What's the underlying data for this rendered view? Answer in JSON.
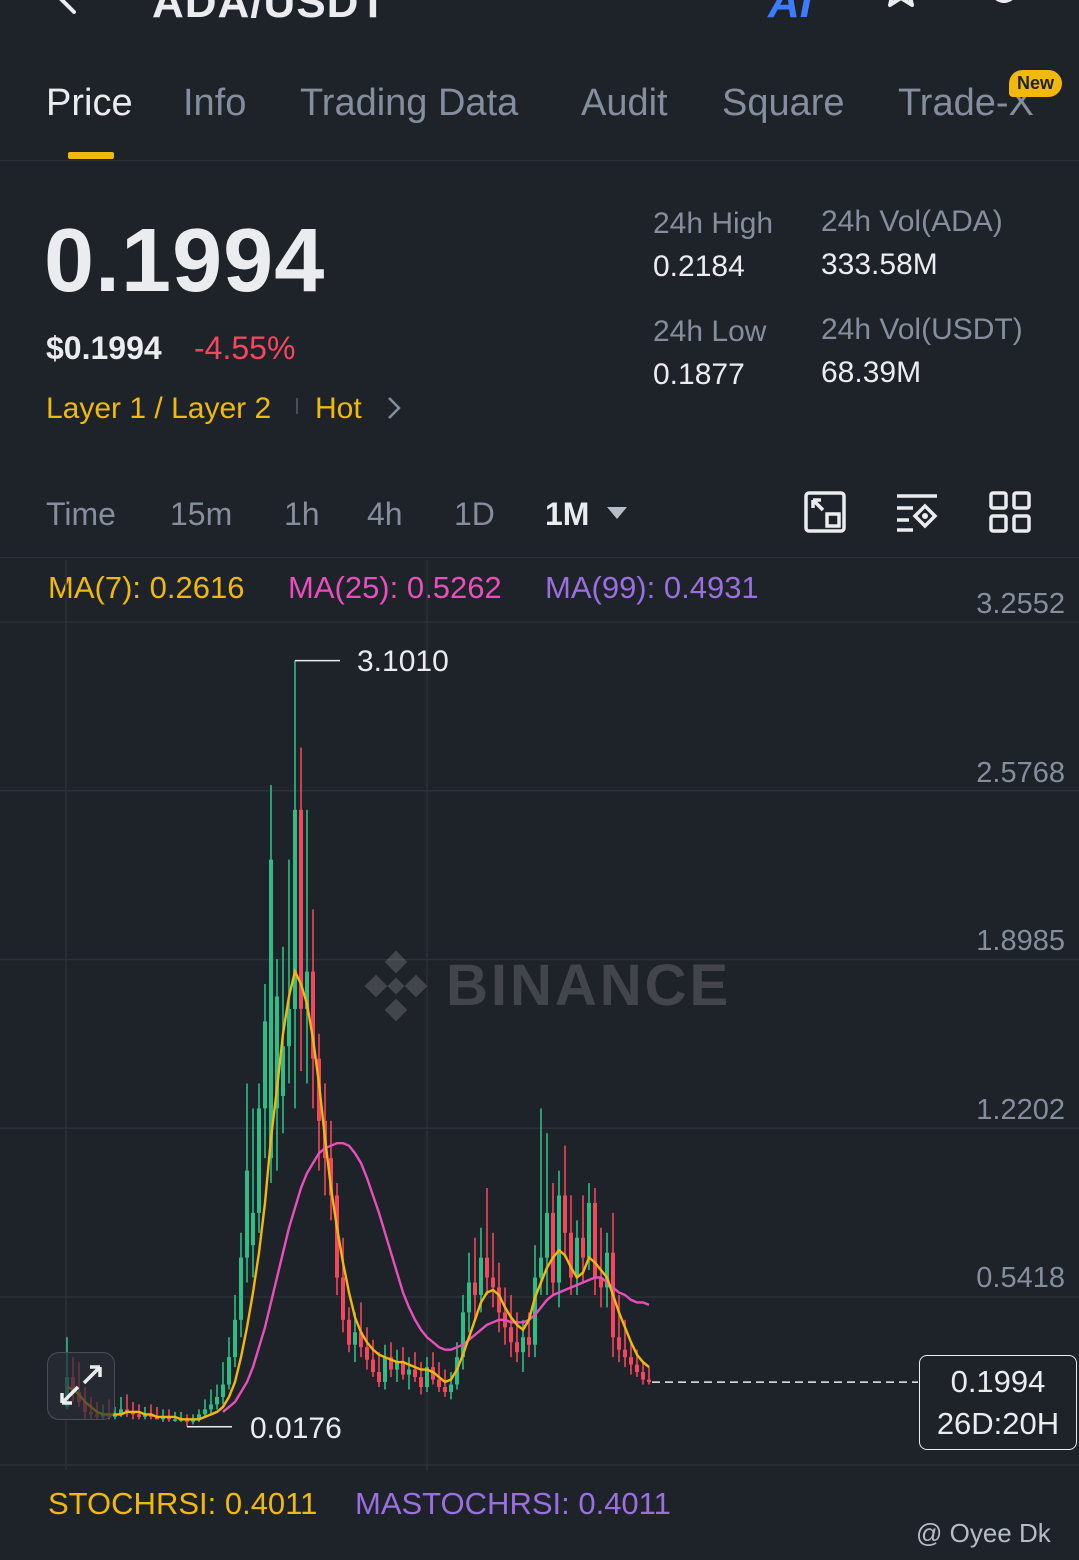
{
  "header": {
    "pair_title": "ADA/USDT",
    "ai_label": "AI",
    "icons": [
      "back-icon",
      "ai-icon",
      "star-icon",
      "bell-icon"
    ]
  },
  "tabs": [
    {
      "label": "Price",
      "active": true
    },
    {
      "label": "Info",
      "active": false
    },
    {
      "label": "Trading Data",
      "active": false
    },
    {
      "label": "Audit",
      "active": false
    },
    {
      "label": "Square",
      "active": false
    },
    {
      "label": "Trade-X",
      "active": false,
      "badge": "New"
    }
  ],
  "ticker": {
    "last_price": "0.1994",
    "usd_price": "$0.1994",
    "change_pct": "-4.55%",
    "tag_category": "Layer 1 / Layer 2",
    "tag_hot": "Hot",
    "stats": {
      "high_label": "24h High",
      "high_value": "0.2184",
      "low_label": "24h Low",
      "low_value": "0.1877",
      "vol_base_label": "24h Vol(ADA)",
      "vol_base_value": "333.58M",
      "vol_quote_label": "24h Vol(USDT)",
      "vol_quote_value": "68.39M"
    }
  },
  "intervals": {
    "items": [
      "Time",
      "15m",
      "1h",
      "4h",
      "1D",
      "1M"
    ],
    "active": "1M",
    "tools": [
      "chart-fullscreen-icon",
      "indicator-settings-icon",
      "layout-grid-icon"
    ]
  },
  "indicators": {
    "ma7": "MA(7): 0.2616",
    "ma25": "MA(25): 0.5262",
    "ma99": "MA(99): 0.4931",
    "stochrsi": "STOCHRSI: 0.4011",
    "mastochrsi": "MASTOCHRSI: 0.4011"
  },
  "chart": {
    "watermark": "BINANCE",
    "high_marker": "3.1010",
    "low_marker": "0.0176",
    "current_price": "0.1994",
    "countdown": "26D:20H",
    "credit": "@ Oyee Dk"
  },
  "chart_data": {
    "type": "candlestick",
    "y_ticks": [
      "3.2552",
      "2.5768",
      "1.8985",
      "1.2202",
      "0.5418"
    ],
    "ylim": [
      0.05,
      3.35
    ],
    "colors": {
      "up": "#2ebd85",
      "down": "#f6465d",
      "ma7": "#f0b90b",
      "ma25": "#e84fbd",
      "ma99": "#9b6fe0"
    },
    "candles": [
      [
        0.1,
        0.38,
        0.09,
        0.22
      ],
      [
        0.22,
        0.3,
        0.12,
        0.16
      ],
      [
        0.16,
        0.28,
        0.1,
        0.12
      ],
      [
        0.12,
        0.18,
        0.05,
        0.08
      ],
      [
        0.08,
        0.14,
        0.05,
        0.07
      ],
      [
        0.07,
        0.12,
        0.05,
        0.06
      ],
      [
        0.06,
        0.11,
        0.05,
        0.07
      ],
      [
        0.07,
        0.13,
        0.05,
        0.06
      ],
      [
        0.06,
        0.1,
        0.05,
        0.07
      ],
      [
        0.07,
        0.14,
        0.06,
        0.09
      ],
      [
        0.09,
        0.15,
        0.06,
        0.08
      ],
      [
        0.08,
        0.12,
        0.05,
        0.07
      ],
      [
        0.07,
        0.11,
        0.05,
        0.06
      ],
      [
        0.06,
        0.1,
        0.05,
        0.07
      ],
      [
        0.07,
        0.11,
        0.05,
        0.06
      ],
      [
        0.06,
        0.1,
        0.05,
        0.05
      ],
      [
        0.05,
        0.09,
        0.04,
        0.06
      ],
      [
        0.06,
        0.09,
        0.04,
        0.05
      ],
      [
        0.05,
        0.08,
        0.04,
        0.05
      ],
      [
        0.05,
        0.08,
        0.04,
        0.05
      ],
      [
        0.05,
        0.07,
        0.02,
        0.04
      ],
      [
        0.04,
        0.07,
        0.03,
        0.05
      ],
      [
        0.05,
        0.09,
        0.04,
        0.07
      ],
      [
        0.07,
        0.13,
        0.06,
        0.09
      ],
      [
        0.09,
        0.17,
        0.07,
        0.11
      ],
      [
        0.11,
        0.19,
        0.09,
        0.14
      ],
      [
        0.14,
        0.28,
        0.11,
        0.19
      ],
      [
        0.19,
        0.38,
        0.17,
        0.3
      ],
      [
        0.3,
        0.55,
        0.26,
        0.45
      ],
      [
        0.45,
        0.8,
        0.38,
        0.7
      ],
      [
        0.7,
        1.4,
        0.6,
        1.05
      ],
      [
        0.75,
        1.3,
        0.62,
        0.88
      ],
      [
        0.88,
        1.4,
        0.8,
        1.3
      ],
      [
        1.3,
        1.8,
        1.1,
        1.65
      ],
      [
        1.1,
        2.6,
        1.0,
        2.3
      ],
      [
        1.3,
        1.9,
        1.05,
        1.75
      ],
      [
        1.35,
        1.95,
        1.2,
        1.55
      ],
      [
        1.55,
        2.3,
        1.4,
        1.7
      ],
      [
        1.7,
        3.1,
        1.3,
        2.5
      ],
      [
        2.5,
        2.75,
        1.45,
        1.7
      ],
      [
        1.7,
        2.5,
        1.4,
        1.85
      ],
      [
        1.85,
        2.1,
        1.3,
        1.5
      ],
      [
        1.5,
        1.6,
        1.05,
        1.25
      ],
      [
        1.25,
        1.4,
        0.95,
        1.1
      ],
      [
        1.1,
        1.25,
        0.85,
        0.95
      ],
      [
        0.95,
        1.0,
        0.55,
        0.62
      ],
      [
        0.62,
        0.78,
        0.4,
        0.45
      ],
      [
        0.45,
        0.5,
        0.32,
        0.35
      ],
      [
        0.35,
        0.48,
        0.28,
        0.4
      ],
      [
        0.4,
        0.52,
        0.3,
        0.34
      ],
      [
        0.34,
        0.42,
        0.25,
        0.29
      ],
      [
        0.29,
        0.37,
        0.22,
        0.24
      ],
      [
        0.24,
        0.32,
        0.18,
        0.2
      ],
      [
        0.2,
        0.35,
        0.17,
        0.3
      ],
      [
        0.3,
        0.36,
        0.22,
        0.25
      ],
      [
        0.25,
        0.33,
        0.2,
        0.28
      ],
      [
        0.28,
        0.34,
        0.21,
        0.23
      ],
      [
        0.23,
        0.3,
        0.17,
        0.25
      ],
      [
        0.25,
        0.32,
        0.2,
        0.22
      ],
      [
        0.22,
        0.28,
        0.15,
        0.18
      ],
      [
        0.18,
        0.3,
        0.16,
        0.26
      ],
      [
        0.26,
        0.32,
        0.19,
        0.21
      ],
      [
        0.21,
        0.28,
        0.16,
        0.18
      ],
      [
        0.18,
        0.25,
        0.14,
        0.16
      ],
      [
        0.16,
        0.24,
        0.13,
        0.19
      ],
      [
        0.19,
        0.36,
        0.17,
        0.3
      ],
      [
        0.3,
        0.55,
        0.25,
        0.48
      ],
      [
        0.48,
        0.72,
        0.4,
        0.6
      ],
      [
        0.6,
        0.78,
        0.45,
        0.55
      ],
      [
        0.55,
        0.82,
        0.48,
        0.7
      ],
      [
        0.7,
        0.98,
        0.55,
        0.62
      ],
      [
        0.62,
        0.8,
        0.5,
        0.58
      ],
      [
        0.58,
        0.68,
        0.4,
        0.48
      ],
      [
        0.48,
        0.58,
        0.35,
        0.42
      ],
      [
        0.42,
        0.55,
        0.3,
        0.36
      ],
      [
        0.36,
        0.48,
        0.28,
        0.32
      ],
      [
        0.32,
        0.45,
        0.24,
        0.38
      ],
      [
        0.38,
        0.48,
        0.3,
        0.35
      ],
      [
        0.35,
        0.75,
        0.3,
        0.62
      ],
      [
        0.62,
        1.3,
        0.55,
        0.7
      ],
      [
        0.7,
        1.2,
        0.55,
        0.88
      ],
      [
        0.88,
        1.0,
        0.55,
        0.6
      ],
      [
        0.6,
        1.05,
        0.5,
        0.95
      ],
      [
        0.95,
        1.15,
        0.7,
        0.8
      ],
      [
        0.8,
        0.95,
        0.55,
        0.62
      ],
      [
        0.62,
        0.85,
        0.55,
        0.78
      ],
      [
        0.78,
        0.95,
        0.6,
        0.7
      ],
      [
        0.7,
        1.0,
        0.65,
        0.92
      ],
      [
        0.92,
        0.98,
        0.55,
        0.62
      ],
      [
        0.62,
        0.82,
        0.5,
        0.58
      ],
      [
        0.58,
        0.8,
        0.5,
        0.72
      ],
      [
        0.72,
        0.88,
        0.3,
        0.38
      ],
      [
        0.38,
        0.55,
        0.28,
        0.33
      ],
      [
        0.33,
        0.45,
        0.26,
        0.3
      ],
      [
        0.3,
        0.36,
        0.23,
        0.27
      ],
      [
        0.27,
        0.33,
        0.22,
        0.24
      ],
      [
        0.24,
        0.28,
        0.19,
        0.21
      ],
      [
        0.21,
        0.26,
        0.19,
        0.2
      ]
    ],
    "ma7": [
      0.18,
      0.17,
      0.15,
      0.12,
      0.1,
      0.08,
      0.07,
      0.07,
      0.07,
      0.07,
      0.08,
      0.08,
      0.08,
      0.07,
      0.07,
      0.06,
      0.06,
      0.06,
      0.06,
      0.05,
      0.05,
      0.05,
      0.05,
      0.06,
      0.07,
      0.08,
      0.1,
      0.14,
      0.2,
      0.3,
      0.42,
      0.56,
      0.72,
      0.92,
      1.18,
      1.38,
      1.6,
      1.75,
      1.85,
      1.8,
      1.72,
      1.58,
      1.4,
      1.18,
      0.98,
      0.82,
      0.68,
      0.56,
      0.46,
      0.4,
      0.36,
      0.33,
      0.31,
      0.3,
      0.29,
      0.28,
      0.28,
      0.27,
      0.26,
      0.25,
      0.25,
      0.24,
      0.22,
      0.2,
      0.21,
      0.25,
      0.31,
      0.38,
      0.45,
      0.52,
      0.56,
      0.57,
      0.55,
      0.5,
      0.46,
      0.43,
      0.41,
      0.45,
      0.54,
      0.6,
      0.66,
      0.7,
      0.73,
      0.71,
      0.66,
      0.62,
      0.64,
      0.7,
      0.68,
      0.65,
      0.62,
      0.55,
      0.48,
      0.42,
      0.36,
      0.31,
      0.28,
      0.26
    ],
    "ma25": [
      0.12,
      0.12,
      0.12,
      0.11,
      0.1,
      0.1,
      0.09,
      0.09,
      0.08,
      0.08,
      0.08,
      0.08,
      0.07,
      0.07,
      0.07,
      0.07,
      0.07,
      0.06,
      0.06,
      0.06,
      0.06,
      0.06,
      0.06,
      0.06,
      0.07,
      0.07,
      0.08,
      0.1,
      0.12,
      0.16,
      0.2,
      0.26,
      0.34,
      0.42,
      0.52,
      0.62,
      0.72,
      0.82,
      0.9,
      0.98,
      1.04,
      1.08,
      1.12,
      1.14,
      1.15,
      1.16,
      1.16,
      1.15,
      1.12,
      1.08,
      1.02,
      0.95,
      0.88,
      0.8,
      0.72,
      0.64,
      0.56,
      0.5,
      0.45,
      0.41,
      0.38,
      0.36,
      0.34,
      0.33,
      0.33,
      0.34,
      0.35,
      0.37,
      0.39,
      0.41,
      0.43,
      0.44,
      0.45,
      0.45,
      0.44,
      0.44,
      0.44,
      0.45,
      0.47,
      0.5,
      0.53,
      0.55,
      0.56,
      0.57,
      0.58,
      0.59,
      0.6,
      0.61,
      0.62,
      0.62,
      0.6,
      0.58,
      0.56,
      0.55,
      0.53,
      0.52,
      0.52,
      0.51
    ],
    "ma25_start_index": 26
  }
}
